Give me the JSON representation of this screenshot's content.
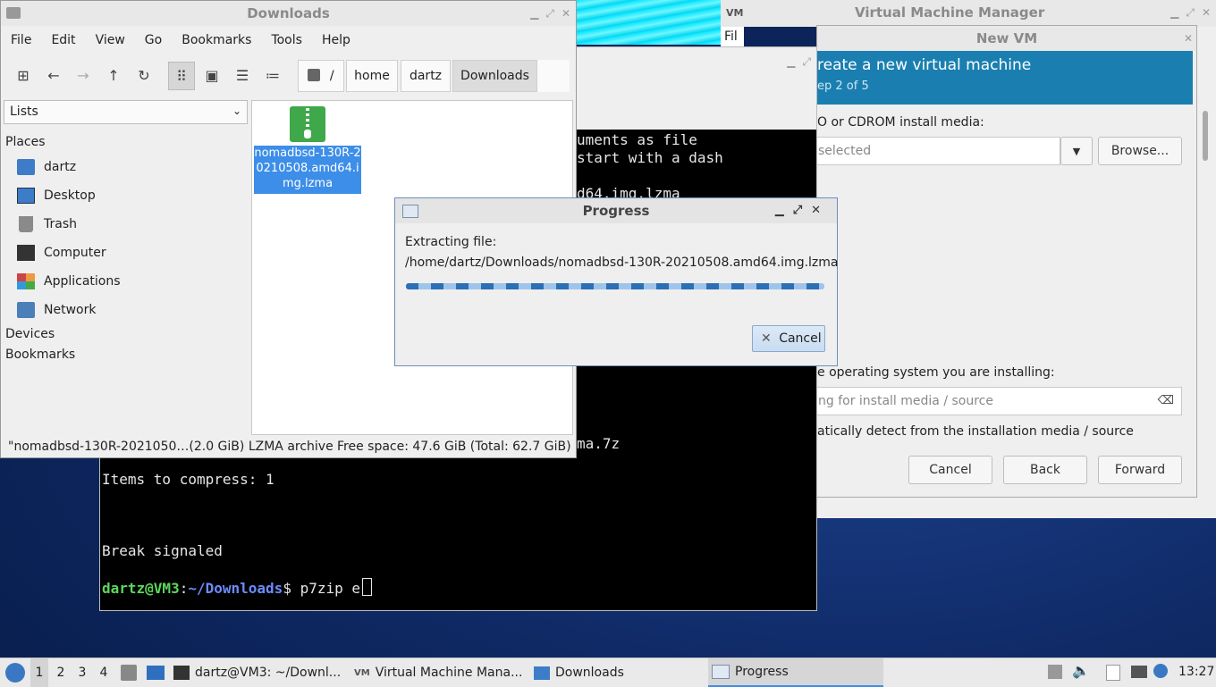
{
  "virt_manager": {
    "title": "Virtual Machine Manager",
    "file_label": "Fil",
    "newvm_title": "New VM",
    "header_title": "reate a new virtual machine",
    "header_step": "ep 2 of 5",
    "install_media_label": "O or CDROM install media:",
    "media_combo_value": "selected",
    "browse_label": "Browse...",
    "os_label": "e operating system you are installing:",
    "os_search_placeholder": "ng for install media / source",
    "auto_detect_label": "atically detect from the installation media / source",
    "cancel_label": "Cancel",
    "back_label": "Back",
    "forward_label": "Forward"
  },
  "terminal": {
    "lines_top": [
      "uments as file",
      "start with a dash",
      "",
      "d64.img.lzma"
    ],
    "line_archive": "ma.7z",
    "line_items": "Items to compress: 1",
    "line_break": "Break signaled",
    "prompt_user": "dartz@VM3",
    "prompt_sep": ":",
    "prompt_path": "~/Downloads",
    "prompt_dollar": "$ ",
    "command": "p7zip e"
  },
  "file_manager": {
    "title": "Downloads",
    "menu": [
      "File",
      "Edit",
      "View",
      "Go",
      "Bookmarks",
      "Tools",
      "Help"
    ],
    "breadcrumb": [
      "/",
      "home",
      "dartz",
      "Downloads"
    ],
    "side_combo": "Lists",
    "places_header": "Places",
    "places": [
      "dartz",
      "Desktop",
      "Trash",
      "Computer",
      "Applications",
      "Network"
    ],
    "devices_header": "Devices",
    "bookmarks_header": "Bookmarks",
    "file_name": "nomadbsd-130R-20210508.amd64.img.lzma",
    "status_left": "\"nomadbsd-130R-2021050…(2.0 GiB) LZMA archive",
    "status_right": "Free space: 47.6 GiB (Total: 62.7 GiB)"
  },
  "progress_dialog": {
    "title": "Progress",
    "extracting_label": "Extracting file:",
    "file_path": "/home/dartz/Downloads/nomadbsd-130R-20210508.amd64.img.lzma",
    "cancel_label": "Cancel"
  },
  "taskbar": {
    "workspaces": [
      "1",
      "2",
      "3",
      "4"
    ],
    "tasks": [
      "dartz@VM3: ~/Downl...",
      "Virtual Machine Mana...",
      "Downloads",
      "Progress"
    ],
    "clock": "13:27"
  },
  "colors": {
    "accent_blue": "#1a7fb0",
    "selection": "#3d8ee8",
    "prompt_green": "#5cd65c",
    "prompt_blue": "#6b8cff"
  }
}
